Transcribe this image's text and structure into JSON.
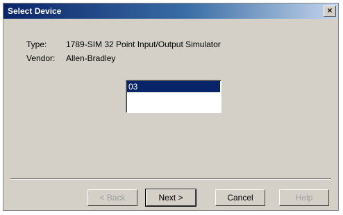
{
  "dialog": {
    "title": "Select Device",
    "close_label": "×"
  },
  "fields": {
    "type_label": "Type:",
    "type_value": "1789-SIM 32 Point Input/Output Simulator",
    "vendor_label": "Vendor:",
    "vendor_value": "Allen-Bradley"
  },
  "device_list": {
    "items": [
      "03"
    ],
    "selected": "03"
  },
  "buttons": {
    "back": "< Back",
    "next": "Next >",
    "cancel": "Cancel",
    "help": "Help"
  }
}
